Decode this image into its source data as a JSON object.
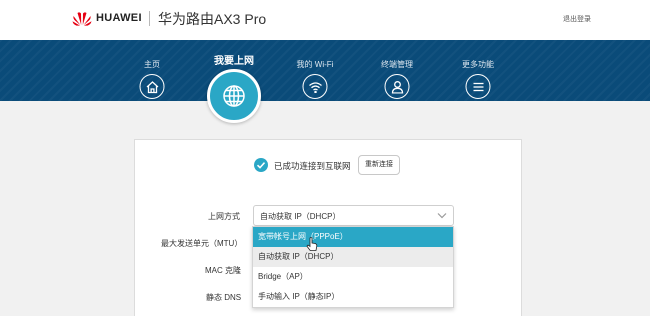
{
  "header": {
    "brand": "HUAWEI",
    "product": "华为路由AX3 Pro",
    "logout_label": "退出登录"
  },
  "nav": {
    "items": [
      {
        "label": "主页",
        "icon": "home-icon"
      },
      {
        "label": "我要上网",
        "icon": "globe-icon",
        "active": true
      },
      {
        "label": "我的 Wi-Fi",
        "icon": "wifi-icon"
      },
      {
        "label": "终端管理",
        "icon": "user-icon"
      },
      {
        "label": "更多功能",
        "icon": "menu-icon"
      }
    ]
  },
  "status": {
    "text": "已成功连接到互联网",
    "reconnect_label": "重新连接"
  },
  "form": {
    "labels": {
      "connection_type": "上网方式",
      "mtu": "最大发送单元（MTU）",
      "mac_clone": "MAC 克隆",
      "static_dns": "静态 DNS"
    },
    "connection_type_value": "自动获取 IP（DHCP）",
    "options": [
      {
        "label": "宽带帐号上网（PPPoE）",
        "state": "hover"
      },
      {
        "label": "自动获取 IP（DHCP）",
        "state": "selected"
      },
      {
        "label": "Bridge（AP）",
        "state": "normal"
      },
      {
        "label": "手动输入 IP（静态IP）",
        "state": "normal"
      }
    ]
  },
  "colors": {
    "banner": "#0a4b79",
    "accent": "#2aa7c6"
  }
}
